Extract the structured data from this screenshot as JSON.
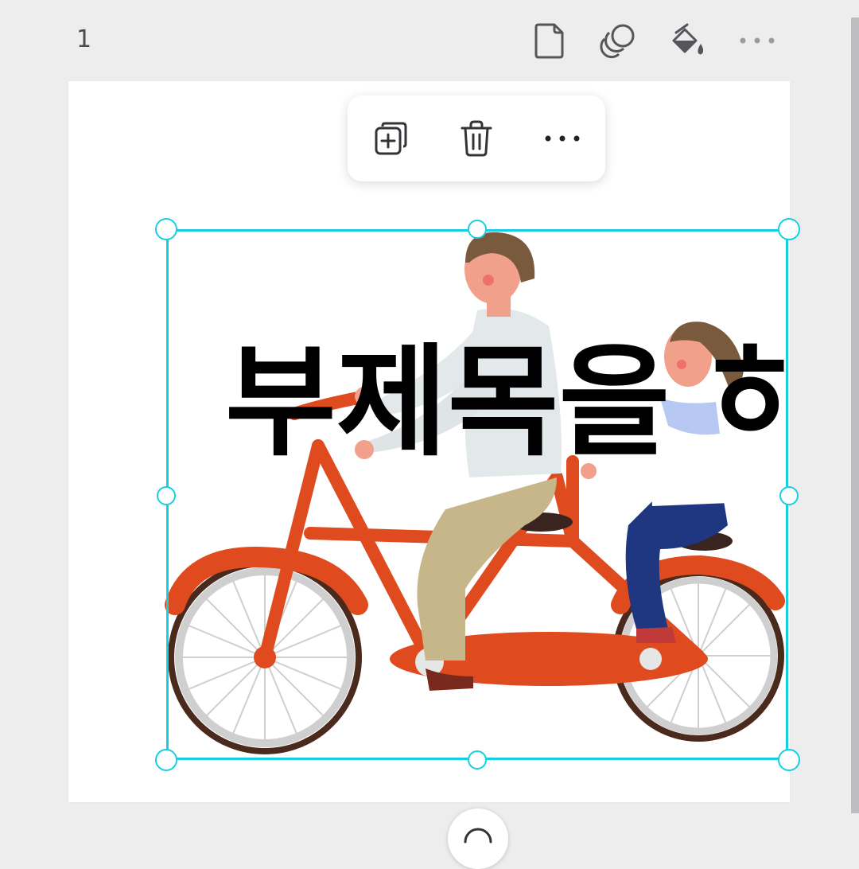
{
  "page": {
    "number": "1"
  },
  "page_toolbar": {
    "icons": [
      "page-icon",
      "layers-icon",
      "fill-color-icon",
      "more-options-icon"
    ]
  },
  "context_toolbar": {
    "icons": [
      "duplicate-icon",
      "delete-icon",
      "more-options-icon"
    ]
  },
  "canvas": {
    "text_element": "부제목을 하"
  },
  "colors": {
    "selection": "#17cfe0",
    "background": "#ededee",
    "bicycle": "#e04a1f"
  }
}
